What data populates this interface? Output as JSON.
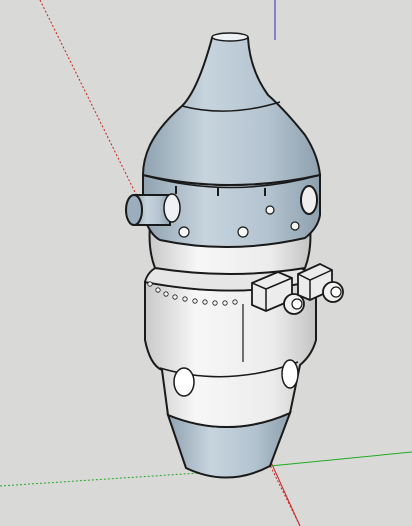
{
  "app": {
    "type": "3d-modeling-viewport"
  },
  "colors": {
    "background": "#d9d9d7",
    "shell_blue": "#b9c8d4",
    "shell_blue_dark": "#8fa2b0",
    "shell_white": "#f2f2f2",
    "shell_shadow": "#b8b8b8",
    "edge": "#1a1a1a",
    "axis_red": "#cc2222",
    "axis_green": "#22aa22",
    "axis_blue": "#2a2acc"
  },
  "model": {
    "name": "",
    "parts": [
      "nose-cone",
      "upper-ring",
      "side-nozzle",
      "middle-section",
      "perforated-ring",
      "connector-blocks",
      "lower-section",
      "tail-cone"
    ]
  },
  "icons": [
    "axis-red-icon",
    "axis-green-icon",
    "axis-blue-icon"
  ]
}
